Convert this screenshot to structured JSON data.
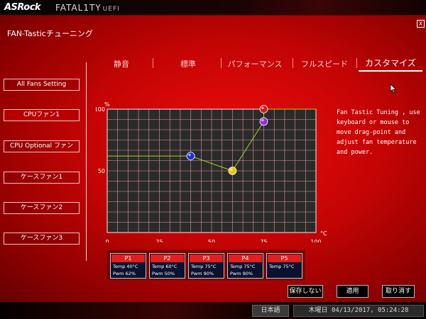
{
  "brand": {
    "logo": "ASRock",
    "product": "FATAL1TY",
    "product_suffix": "UEFI"
  },
  "window": {
    "title": "FAN-Tasticチューニング",
    "close_label": "X"
  },
  "tabs": [
    {
      "label": "静音",
      "active": false
    },
    {
      "label": "標準",
      "active": false
    },
    {
      "label": "パフォーマンス",
      "active": false
    },
    {
      "label": "フルスピード",
      "active": false
    },
    {
      "label": "カスタマイズ",
      "active": true
    }
  ],
  "sidebar": {
    "items": [
      {
        "label": "All Fans Setting",
        "active": false
      },
      {
        "label": "CPUファン1",
        "active": true
      },
      {
        "label": "CPU Optional ファン",
        "active": false
      },
      {
        "label": "ケースファン1",
        "active": false
      },
      {
        "label": "ケースファン2",
        "active": false
      },
      {
        "label": "ケースファン3",
        "active": false
      }
    ]
  },
  "help_text": "Fan Tastic Tuning , use keyboard or mouse to move drag-point and adjust fan temperature and power.",
  "chart_data": {
    "type": "line",
    "y_unit": "%",
    "x_unit": "°C",
    "xlim": [
      0,
      100
    ],
    "ylim": [
      0,
      100
    ],
    "x_ticks": [
      0,
      25,
      50,
      75,
      100
    ],
    "y_ticks": [
      50,
      100
    ],
    "grid": true,
    "line_color": "#9ad82e",
    "points": [
      {
        "name": "P1",
        "x": 40,
        "y": 62,
        "color": "#1d2ee0"
      },
      {
        "name": "P2",
        "x": 60,
        "y": 50,
        "color": "#e8c800"
      },
      {
        "name": "P3",
        "x": 75,
        "y": 90,
        "color": "#9a2ad8"
      },
      {
        "name": "P4",
        "x": 75,
        "y": 90,
        "color": "#9a2ad8"
      },
      {
        "name": "P5",
        "x": 75,
        "y": 100,
        "color": "#e01818"
      }
    ]
  },
  "point_panel": [
    {
      "name": "P1",
      "temp_label": "Temp",
      "temp": "40°C",
      "pwm_label": "Pwm",
      "pwm": "62%"
    },
    {
      "name": "P2",
      "temp_label": "Temp",
      "temp": "60°C",
      "pwm_label": "Pwm",
      "pwm": "50%"
    },
    {
      "name": "P3",
      "temp_label": "Temp",
      "temp": "75°C",
      "pwm_label": "Pwm",
      "pwm": "90%"
    },
    {
      "name": "P4",
      "temp_label": "Temp",
      "temp": "75°C",
      "pwm_label": "Pwm",
      "pwm": "90%"
    },
    {
      "name": "P5",
      "temp_label": "Temp",
      "temp": "75°C",
      "pwm_label": "",
      "pwm": ""
    }
  ],
  "actions": {
    "save": "保存しない",
    "apply": "適用",
    "cancel": "取り消す"
  },
  "footer": {
    "language": "日本語",
    "datetime": "木曜日 04/13/2017, 05:24:28"
  },
  "colors": {
    "background_red": "#d40000",
    "graph_bg": "#2a2a2a",
    "grid": "#e39a9a"
  }
}
